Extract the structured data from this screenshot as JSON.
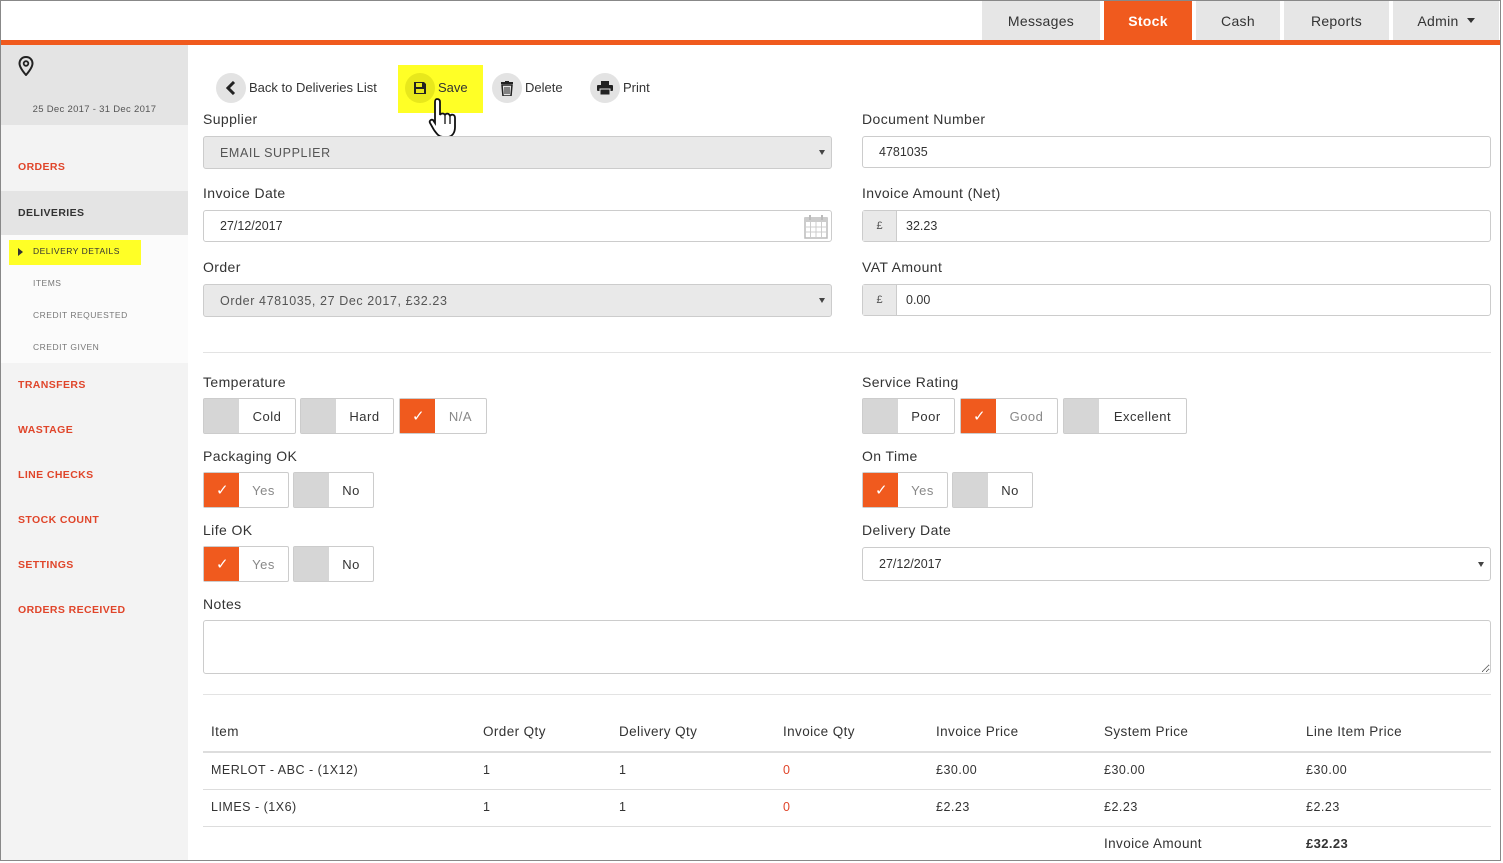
{
  "nav": {
    "tabs": [
      {
        "label": "Messages"
      },
      {
        "label": "Stock"
      },
      {
        "label": "Cash"
      },
      {
        "label": "Reports"
      },
      {
        "label": "Admin"
      }
    ],
    "active": "Stock"
  },
  "sidebar": {
    "date_range": "25 Dec 2017 - 31 Dec 2017",
    "items": [
      {
        "label": "ORDERS"
      },
      {
        "label": "DELIVERIES"
      },
      {
        "label": "TRANSFERS"
      },
      {
        "label": "WASTAGE"
      },
      {
        "label": "LINE CHECKS"
      },
      {
        "label": "STOCK COUNT"
      },
      {
        "label": "SETTINGS"
      },
      {
        "label": "ORDERS RECEIVED"
      }
    ],
    "sub_items": [
      {
        "label": "DELIVERY DETAILS"
      },
      {
        "label": "ITEMS"
      },
      {
        "label": "CREDIT REQUESTED"
      },
      {
        "label": "CREDIT GIVEN"
      }
    ]
  },
  "toolbar": {
    "back_label": "Back to Deliveries List",
    "save_label": "Save",
    "delete_label": "Delete",
    "print_label": "Print"
  },
  "form": {
    "supplier": {
      "label": "Supplier",
      "value": "EMAIL SUPPLIER"
    },
    "document_number": {
      "label": "Document Number",
      "value": "4781035"
    },
    "invoice_date": {
      "label": "Invoice Date",
      "value": "27/12/2017"
    },
    "invoice_amount": {
      "label": "Invoice Amount (Net)",
      "currency": "£",
      "value": "32.23"
    },
    "order": {
      "label": "Order",
      "value": "Order 4781035, 27 Dec 2017, £32.23"
    },
    "vat_amount": {
      "label": "VAT Amount",
      "currency": "£",
      "value": "0.00"
    },
    "temperature": {
      "label": "Temperature",
      "options": [
        "Cold",
        "Hard",
        "N/A"
      ],
      "selected": "N/A"
    },
    "service_rating": {
      "label": "Service Rating",
      "options": [
        "Poor",
        "Good",
        "Excellent"
      ],
      "selected": "Good"
    },
    "packaging_ok": {
      "label": "Packaging OK",
      "options": [
        "Yes",
        "No"
      ],
      "selected": "Yes"
    },
    "on_time": {
      "label": "On Time",
      "options": [
        "Yes",
        "No"
      ],
      "selected": "Yes"
    },
    "life_ok": {
      "label": "Life OK",
      "options": [
        "Yes",
        "No"
      ],
      "selected": "Yes"
    },
    "delivery_date": {
      "label": "Delivery Date",
      "value": "27/12/2017"
    },
    "notes": {
      "label": "Notes",
      "value": ""
    }
  },
  "table": {
    "headers": [
      "Item",
      "Order Qty",
      "Delivery Qty",
      "Invoice Qty",
      "Invoice Price",
      "System Price",
      "Line Item Price"
    ],
    "rows": [
      [
        "MERLOT - ABC - (1X12)",
        "1",
        "1",
        "0",
        "£30.00",
        "£30.00",
        "£30.00"
      ],
      [
        "LIMES - (1X6)",
        "1",
        "1",
        "0",
        "£2.23",
        "£2.23",
        "£2.23"
      ]
    ],
    "footer_label": "Invoice Amount",
    "footer_value": "£32.23"
  },
  "colors": {
    "accent": "#f05a1e",
    "highlight": "#ffff26",
    "sidebar_link": "#e0452a"
  }
}
